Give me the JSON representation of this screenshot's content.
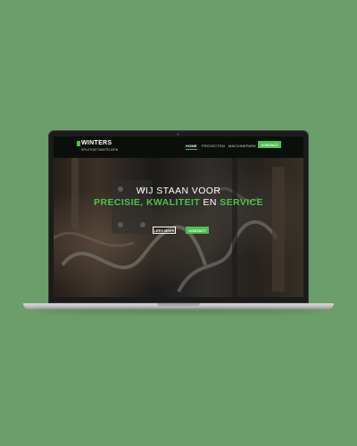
{
  "background_color": "#6c9e6c",
  "accent_color": "#4ec04e",
  "logo": {
    "title": "WINTERS",
    "subtitle": "SPUITGIETMATRIJZEN"
  },
  "nav": {
    "items": [
      {
        "label": "HOME",
        "active": true
      },
      {
        "label": "PROJECTEN",
        "active": false
      },
      {
        "label": "MACHINEPARK",
        "active": false
      }
    ],
    "contact_label": "CONTACT"
  },
  "hero": {
    "line1": "WIJ STAAN VOOR",
    "word1": "PRECISIE,",
    "word2": "KWALITEIT",
    "connector": "EN",
    "word3": "SERVICE",
    "read_more_label": "LEES MEER",
    "contact_label": "CONTACT"
  }
}
